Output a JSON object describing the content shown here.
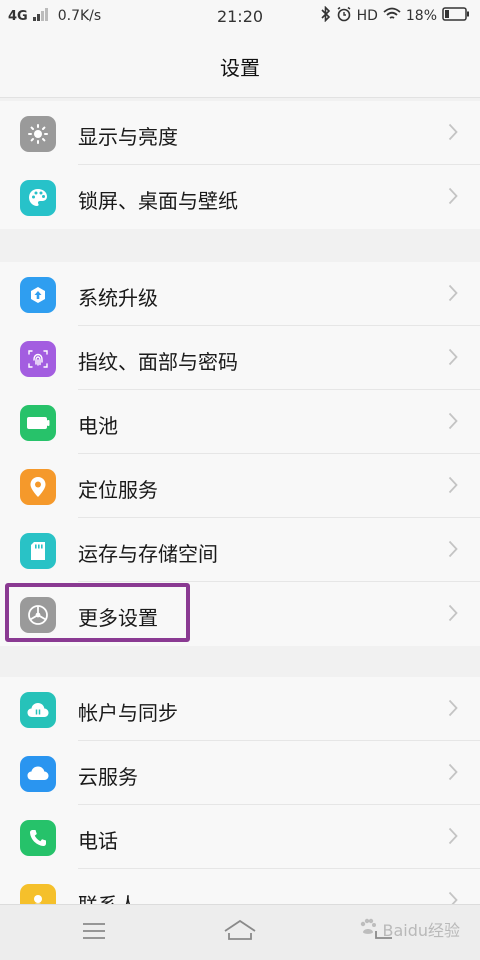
{
  "status_bar": {
    "network": "4G",
    "speed": "0.7K/s",
    "time": "21:20",
    "hd": "HD",
    "battery": "18%"
  },
  "header": {
    "title": "设置"
  },
  "groups": [
    {
      "items": [
        {
          "label": "显示与亮度",
          "icon": "brightness-icon",
          "color": "#9a9a9a"
        },
        {
          "label": "锁屏、桌面与壁纸",
          "icon": "palette-icon",
          "color": "#27c2c9"
        }
      ]
    },
    {
      "items": [
        {
          "label": "系统升级",
          "icon": "upgrade-icon",
          "color": "#2f9ef0"
        },
        {
          "label": "指纹、面部与密码",
          "icon": "fingerprint-icon",
          "color": "#a35de0"
        },
        {
          "label": "电池",
          "icon": "battery-icon",
          "color": "#27c26a"
        },
        {
          "label": "定位服务",
          "icon": "location-icon",
          "color": "#f5992b"
        },
        {
          "label": "运存与存储空间",
          "icon": "storage-icon",
          "color": "#29c2c6"
        },
        {
          "label": "更多设置",
          "icon": "gear-icon",
          "color": "#9a9a9a"
        }
      ]
    },
    {
      "items": [
        {
          "label": "帐户与同步",
          "icon": "cloud-sync-icon",
          "color": "#26c2b9"
        },
        {
          "label": "云服务",
          "icon": "cloud-icon",
          "color": "#2a95f0"
        },
        {
          "label": "电话",
          "icon": "phone-icon",
          "color": "#26c26a"
        },
        {
          "label": "联系人",
          "icon": "contacts-icon",
          "color": "#f5c02b"
        }
      ]
    }
  ],
  "watermark": {
    "text": "Baidu经验"
  }
}
